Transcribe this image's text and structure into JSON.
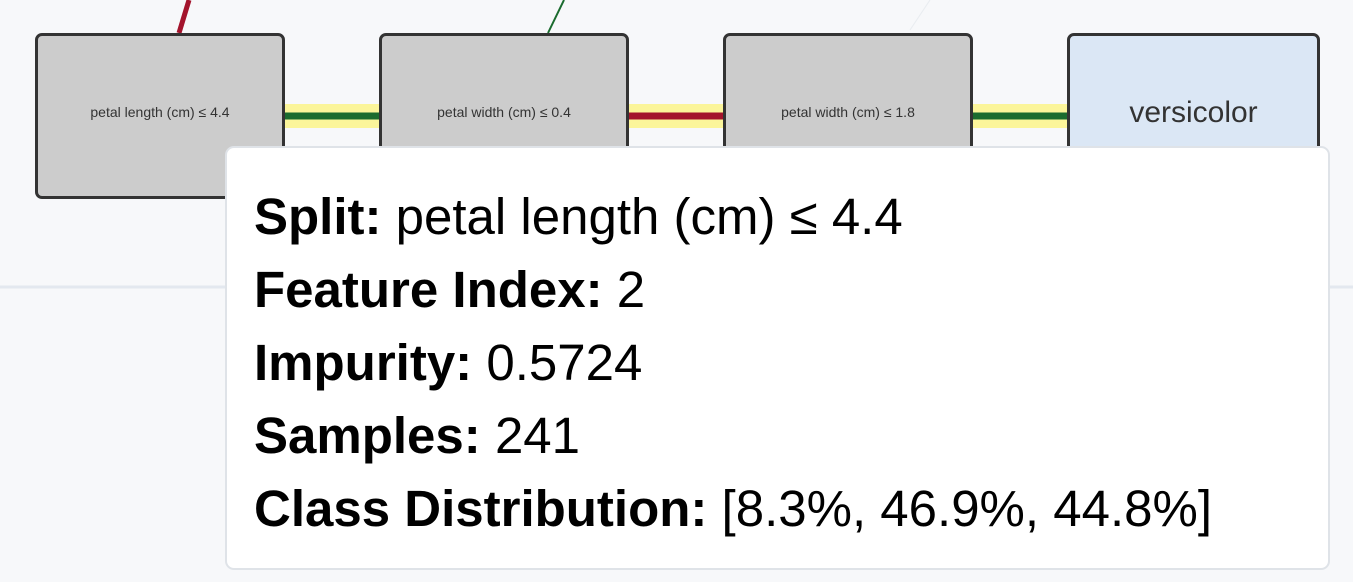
{
  "nodes": [
    {
      "id": "n1",
      "label": "petal length (cm) ≤ 4.4",
      "kind": "split"
    },
    {
      "id": "n2",
      "label": "petal width (cm) ≤ 0.4",
      "kind": "split"
    },
    {
      "id": "n3",
      "label": "petal width (cm) ≤ 1.8",
      "kind": "split"
    },
    {
      "id": "n4",
      "label": "versicolor",
      "kind": "leaf"
    }
  ],
  "tooltip": {
    "split_key": "Split:",
    "split_value": "petal length (cm) ≤ 4.4",
    "feature_index_key": "Feature Index:",
    "feature_index_value": "2",
    "impurity_key": "Impurity:",
    "impurity_value": "0.5724",
    "samples_key": "Samples:",
    "samples_value": "241",
    "class_distribution_key": "Class Distribution:",
    "class_distribution_value": "[8.3%, 46.9%, 44.8%]"
  },
  "colors": {
    "branch_true": "#1a6b2e",
    "branch_false": "#a3142c",
    "path_highlight": "#fbf59a",
    "split_node_fill": "#cccccc",
    "leaf_node_fill": "#dbe7f5",
    "node_border": "#333333"
  }
}
